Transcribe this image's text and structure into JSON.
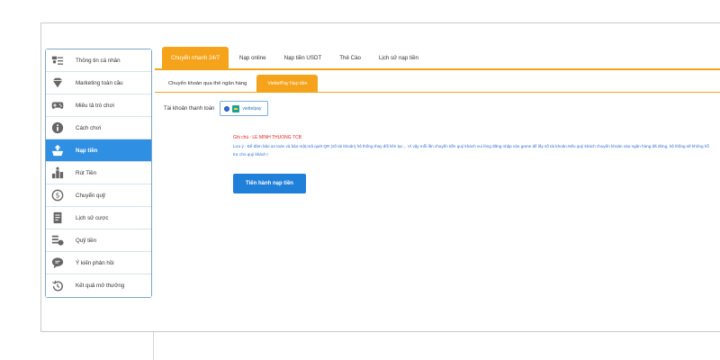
{
  "sidebar": {
    "items": [
      {
        "label": "Thông tin cá nhân",
        "icon": "id-card-icon"
      },
      {
        "label": "Marketing toàn cầu",
        "icon": "diamond-icon"
      },
      {
        "label": "Miêu tả trò chơi",
        "icon": "gamepad-icon"
      },
      {
        "label": "Cách chơi",
        "icon": "info-icon"
      },
      {
        "label": "Nạp tiền",
        "icon": "deposit-icon"
      },
      {
        "label": "Rút Tiền",
        "icon": "withdraw-icon"
      },
      {
        "label": "Chuyển quỹ",
        "icon": "dollar-circle-icon"
      },
      {
        "label": "Lịch sử cược",
        "icon": "history-document-icon"
      },
      {
        "label": "Quỹ tiền",
        "icon": "fund-icon"
      },
      {
        "label": "Ý kiến phản hồi",
        "icon": "chat-bubble-icon"
      },
      {
        "label": "Kết quả mở thưởng",
        "icon": "clock-history-icon"
      }
    ],
    "active_index": 4
  },
  "tabs": {
    "main": [
      "Chuyển nhanh 24/7",
      "Nạp online",
      "Nạp tiền USDT",
      "Thẻ Cào",
      "Lịch sử nạp tiền"
    ],
    "sub": [
      "Chuyển khoản qua thẻ ngân hàng",
      "ViettelPay Nạp tiền"
    ]
  },
  "payment": {
    "account_label": "Tài khoản thanh toán",
    "option_label": "viettelpay"
  },
  "note": {
    "title": "Ghi chú : LE MINH THUONG TCB",
    "text": "Lưu ý : Để đảm bảo an toàn và bảo mật,mã quét QR (số tài khoản) hệ thống thay đổi liên tục ,. Vì vậy mỗi lần chuyển tiền quý khách vui lòng đăng nhập vào game để lấy số tài khoản.Nếu quý khách chuyển khoản vào ngân hàng đã đóng, hệ thống sẽ không hỗ trợ cho quý khách !"
  },
  "submit_label": "Tiến hành nạp tiền",
  "colors": {
    "accent_orange": "#f5a31a",
    "active_blue": "#2f8fe3",
    "button_blue": "#1f7fd9",
    "note_red": "#e01f1f",
    "note_blue": "#2f6fd6"
  }
}
